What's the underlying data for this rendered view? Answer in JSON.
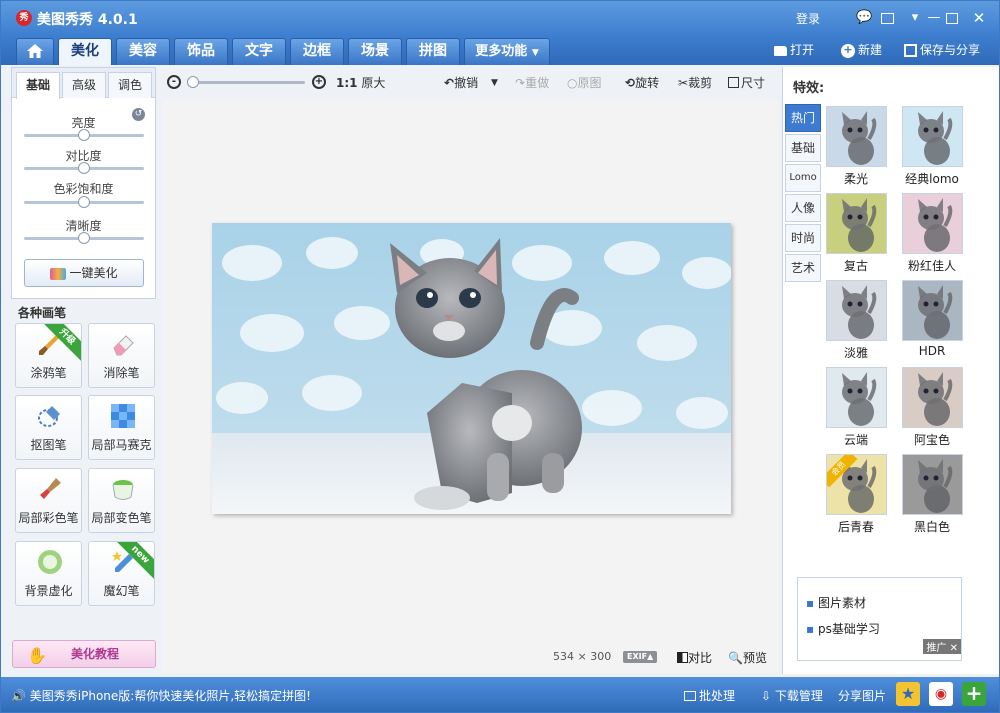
{
  "window": {
    "logo": "秀",
    "title": "美图秀秀 4.0.1",
    "login": "登录"
  },
  "tabs": [
    {
      "label": "美化"
    },
    {
      "label": "美容"
    },
    {
      "label": "饰品"
    },
    {
      "label": "文字"
    },
    {
      "label": "边框"
    },
    {
      "label": "场景"
    },
    {
      "label": "拼图"
    },
    {
      "label": "更多功能"
    }
  ],
  "topbar": {
    "open": "打开",
    "new": "新建",
    "save_share": "保存与分享"
  },
  "subtabs": [
    {
      "label": "基础"
    },
    {
      "label": "高级"
    },
    {
      "label": "调色"
    }
  ],
  "adjust": [
    {
      "label": "亮度",
      "value": 0.5
    },
    {
      "label": "对比度",
      "value": 0.5
    },
    {
      "label": "色彩饱和度",
      "value": 0.5
    },
    {
      "label": "清晰度",
      "value": 0.5
    }
  ],
  "one_key": "一键美化",
  "brushes": {
    "title": "各种画笔",
    "items": [
      {
        "label": "涂鸦笔",
        "badge": "升级",
        "icon": "brush-icon"
      },
      {
        "label": "消除笔",
        "badge": "",
        "icon": "eraser-icon"
      },
      {
        "label": "抠图笔",
        "badge": "",
        "icon": "cutout-pen-icon"
      },
      {
        "label": "局部马赛克",
        "badge": "",
        "icon": "mosaic-icon"
      },
      {
        "label": "局部彩色笔",
        "badge": "",
        "icon": "color-brush-icon"
      },
      {
        "label": "局部变色笔",
        "badge": "",
        "icon": "paint-bucket-icon"
      },
      {
        "label": "背景虚化",
        "badge": "",
        "icon": "blur-icon"
      },
      {
        "label": "魔幻笔",
        "badge": "new",
        "icon": "magic-pen-icon"
      }
    ]
  },
  "tutorial": "美化教程",
  "toolbar": {
    "zoom_ratio": "1:1",
    "original_size": "原大",
    "undo": "撤销",
    "redo": "重做",
    "original": "原图",
    "rotate": "旋转",
    "crop": "裁剪",
    "resize": "尺寸"
  },
  "image_info": {
    "width": "534",
    "times": "×",
    "height": "300",
    "exif": "EXIF▲",
    "compare": "对比",
    "preview": "预览"
  },
  "effects": {
    "title": "特效:",
    "categories": [
      {
        "label": "热门"
      },
      {
        "label": "基础"
      },
      {
        "label": "Lomo"
      },
      {
        "label": "人像"
      },
      {
        "label": "时尚"
      },
      {
        "label": "艺术"
      }
    ],
    "items": [
      {
        "label": "柔光",
        "tint": "#c9d9e8"
      },
      {
        "label": "经典lomo",
        "tint": "#cfe6f3"
      },
      {
        "label": "复古",
        "tint": "#c8cf7e"
      },
      {
        "label": "粉红佳人",
        "tint": "#e9cfd9"
      },
      {
        "label": "淡雅",
        "tint": "#d7dde3"
      },
      {
        "label": "HDR",
        "tint": "#aab7c2"
      },
      {
        "label": "云端",
        "tint": "#dfe9ee"
      },
      {
        "label": "阿宝色",
        "tint": "#d9ccc4"
      },
      {
        "label": "后青春",
        "tint": "#ede2a8",
        "badge": "会员"
      },
      {
        "label": "黑白色",
        "tint": "#9a9a9a"
      }
    ]
  },
  "ad": {
    "line1": "图片素材",
    "line2": "ps基础学习",
    "tag": "推广"
  },
  "status": {
    "message": "美图秀秀iPhone版:帮你快速美化照片,轻松搞定拼图!",
    "batch": "批处理",
    "download": "下载管理",
    "share": "分享图片"
  }
}
